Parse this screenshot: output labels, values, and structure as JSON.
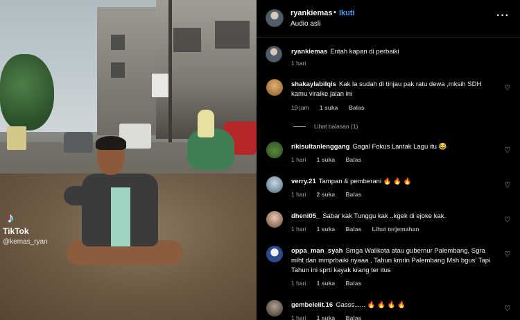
{
  "video": {
    "watermark_brand": "TikTok",
    "watermark_user": "@kemas_ryan"
  },
  "header": {
    "username": "ryankiemas",
    "separator": "•",
    "follow_label": "Ikuti",
    "audio": "Audio asli",
    "more_icon": "more-horizontal-icon"
  },
  "comments": [
    {
      "user": "ryankiemas",
      "text": "Entah kapan di perbaiki",
      "time": "1 hari",
      "likes": "",
      "reply": "",
      "extra": ""
    },
    {
      "user": "shakaylabilqis",
      "text": "Kak la sudah di tinjau pak ratu dewa ,mksih SDH kamu viralke jalan ini",
      "time": "19 jam",
      "likes": "1 suka",
      "reply": "Balas",
      "extra": ""
    },
    {
      "user": "rikisultanlenggang",
      "text": "Gagal Fokus Lantak Lagu itu 😂",
      "time": "1 hari",
      "likes": "1 suka",
      "reply": "Balas",
      "extra": ""
    },
    {
      "user": "verry.21",
      "text": "Tampan & pemberani 🔥 🔥 🔥",
      "time": "1 hari",
      "likes": "2 suka",
      "reply": "Balas",
      "extra": ""
    },
    {
      "user": "dheni05_",
      "text": "Sabar kak Tunggu kak ..kgek di ejoke kak.",
      "time": "1 hari",
      "likes": "1 suka",
      "reply": "Balas",
      "extra": "Lihat terjemahan"
    },
    {
      "user": "oppa_man_syah",
      "text": "Smga Walikota atau gubernur Palembang, Sgra mlht dan mmprbaiki nyaaa , Tahun kmrin Palembang Msh bgus' Tapi Tahun ini sprti kayak krang ter itus",
      "time": "1 hari",
      "likes": "1 suka",
      "reply": "Balas",
      "extra": ""
    },
    {
      "user": "gembelelit.16",
      "text": "Gasss...... 🔥 🔥 🔥 🔥",
      "time": "1 hari",
      "likes": "1 suka",
      "reply": "Balas",
      "extra": ""
    }
  ],
  "view_replies": "Lihat balasan (1)",
  "icons": {
    "like": "heart-outline-icon"
  }
}
